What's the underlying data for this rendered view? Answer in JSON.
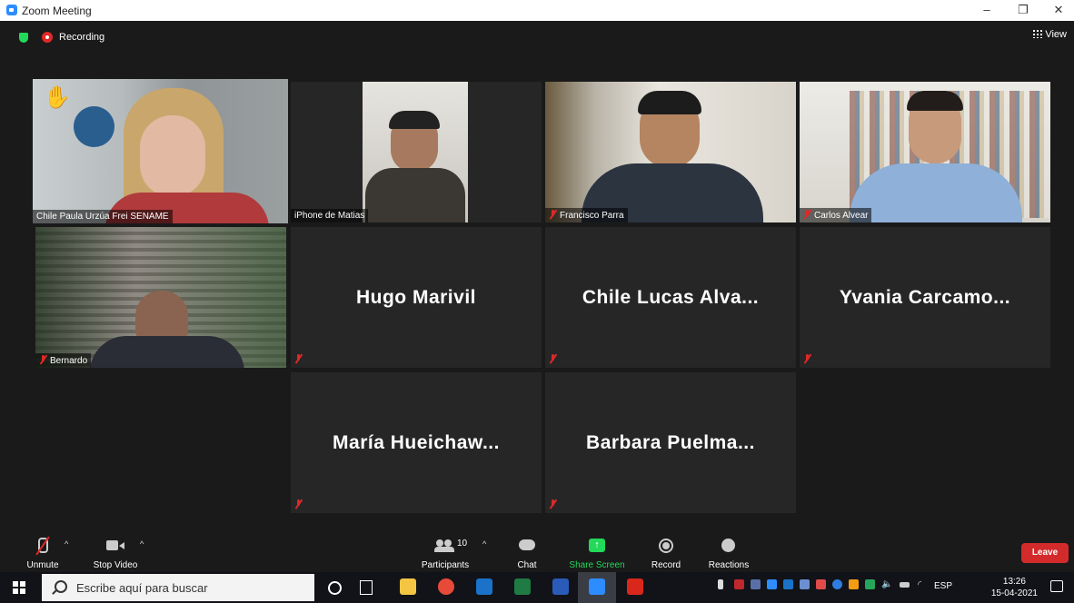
{
  "window": {
    "title": "Zoom Meeting",
    "minimize": "–",
    "maximize": "❐",
    "close": "✕"
  },
  "topbar": {
    "recording_label": "Recording",
    "view_label": "View"
  },
  "tiles": [
    {
      "name": "Chile Paula Urzúa Frei  SENAME",
      "raised_hand": "✋",
      "active": true
    },
    {
      "name": "iPhone de Matias"
    },
    {
      "name": "Francisco Parra",
      "muted": true
    },
    {
      "name": "Carlos Alvear",
      "muted": true
    },
    {
      "name": "Bernardo",
      "muted": true
    },
    {
      "name": "Hugo Marivil",
      "muted": true
    },
    {
      "name": "Chile  Lucas  Alva...",
      "muted": true
    },
    {
      "name": "Yvania  Carcamo...",
      "muted": true
    },
    {
      "name": "María  Hueichaw...",
      "muted": true
    },
    {
      "name": "Barbara  Puelma...",
      "muted": true
    }
  ],
  "toolbar": {
    "unmute": "Unmute",
    "stop_video": "Stop Video",
    "participants": "Participants",
    "participants_count": "10",
    "chat": "Chat",
    "share_screen": "Share Screen",
    "record": "Record",
    "reactions": "Reactions",
    "leave": "Leave",
    "share_color": "#23d959",
    "leave_color": "#d32b2b"
  },
  "taskbar": {
    "search_placeholder": "Escribe aquí para buscar",
    "language": "ESP",
    "time": "13:26",
    "date": "15-04-2021"
  }
}
